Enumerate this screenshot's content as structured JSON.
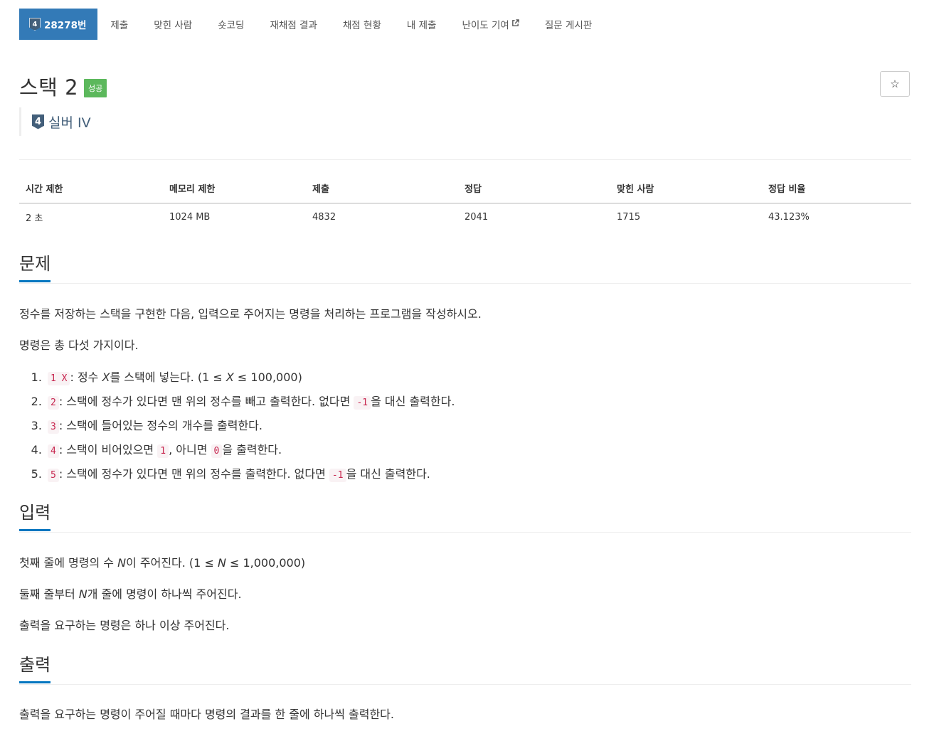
{
  "nav": {
    "tabs": [
      {
        "label": "28278번",
        "tier": "4",
        "active": true
      },
      {
        "label": "제출"
      },
      {
        "label": "맞힌 사람"
      },
      {
        "label": "숏코딩"
      },
      {
        "label": "재채점 결과"
      },
      {
        "label": "채점 현황"
      },
      {
        "label": "내 제출"
      },
      {
        "label": "난이도 기여",
        "icon": "external-link-icon"
      },
      {
        "label": "질문 게시판"
      }
    ]
  },
  "problem": {
    "title": "스택 2",
    "status_badge": "성공",
    "tier_number": "4",
    "tier_label": "실버 IV",
    "star_icon": "☆"
  },
  "info_table": {
    "headers": [
      "시간 제한",
      "메모리 제한",
      "제출",
      "정답",
      "맞힌 사람",
      "정답 비율"
    ],
    "values": [
      "2 초",
      "1024 MB",
      "4832",
      "2041",
      "1715",
      "43.123%"
    ]
  },
  "sections": {
    "problem": {
      "heading": "문제",
      "paragraphs": [
        "정수를 저장하는 스택을 구현한 다음, 입력으로 주어지는 명령을 처리하는 프로그램을 작성하시오.",
        "명령은 총 다섯 가지이다."
      ],
      "commands": [
        {
          "code": "1 X",
          "parts": [
            ": 정수 ",
            "X",
            "를 스택에 넣는다. (1 ≤ ",
            "X",
            " ≤ 100,000)"
          ]
        },
        {
          "code": "2",
          "text1": ": 스택에 정수가 있다면 맨 위의 정수를 빼고 출력한다. 없다면 ",
          "code2": "-1",
          "text2": "을 대신 출력한다."
        },
        {
          "code": "3",
          "text1": ": 스택에 들어있는 정수의 개수를 출력한다."
        },
        {
          "code": "4",
          "text1": ": 스택이 비어있으면 ",
          "code2": "1",
          "text2": ", 아니면 ",
          "code3": "0",
          "text3": "을 출력한다."
        },
        {
          "code": "5",
          "text1": ": 스택에 정수가 있다면 맨 위의 정수를 출력한다. 없다면 ",
          "code2": "-1",
          "text2": "을 대신 출력한다."
        }
      ]
    },
    "input": {
      "heading": "입력",
      "p1": [
        "첫째 줄에 명령의 수 ",
        "N",
        "이 주어진다. (1 ≤ ",
        "N",
        " ≤ 1,000,000)"
      ],
      "p2": [
        "둘째 줄부터 ",
        "N",
        "개 줄에 명령이 하나씩 주어진다."
      ],
      "p3": "출력을 요구하는 명령은 하나 이상 주어진다."
    },
    "output": {
      "heading": "출력",
      "p1": "출력을 요구하는 명령이 주어질 때마다 명령의 결과를 한 줄에 하나씩 출력한다."
    }
  },
  "colors": {
    "active_tab": "#337ab7",
    "success_badge": "#5cb85c",
    "heading_underline": "#0076c0",
    "code_text": "#c7254e",
    "tier_silver": "#435f7a"
  }
}
